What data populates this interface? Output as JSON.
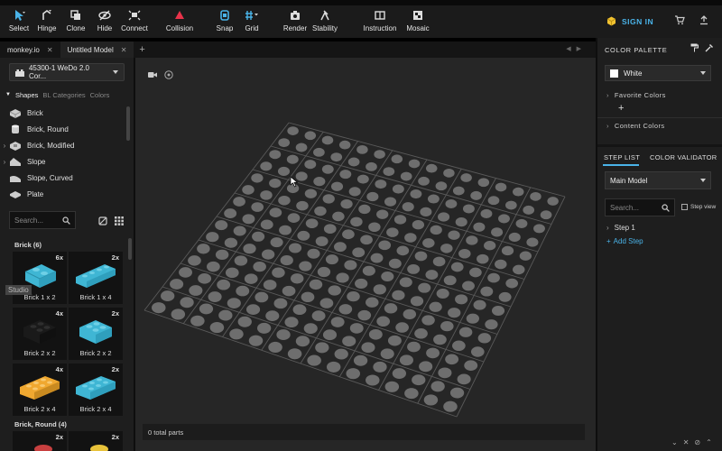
{
  "toolbar": {
    "tools": [
      {
        "label": "Select",
        "icon": "cursor-icon"
      },
      {
        "label": "Hinge",
        "icon": "hinge-icon"
      },
      {
        "label": "Clone",
        "icon": "clone-icon"
      },
      {
        "label": "Hide",
        "icon": "eye-off-icon"
      },
      {
        "label": "Connect",
        "icon": "connect-icon"
      },
      {
        "label": "Collision",
        "icon": "collision-icon"
      },
      {
        "label": "Snap",
        "icon": "snap-icon"
      },
      {
        "label": "Grid",
        "icon": "grid-icon"
      },
      {
        "label": "Render",
        "icon": "camera-icon"
      },
      {
        "label": "Stability",
        "icon": "stability-icon"
      },
      {
        "label": "Instruction",
        "icon": "instruction-icon"
      },
      {
        "label": "Mosaic",
        "icon": "mosaic-icon"
      }
    ],
    "sign_in": "SIGN IN"
  },
  "tabs": [
    {
      "label": "monkey.io"
    },
    {
      "label": "Untitled Model"
    }
  ],
  "left_panel": {
    "set_selector": "45300-1 WeDo 2.0 Cor...",
    "shape_tabs": [
      "Shapes",
      "BL Categories",
      "Colors"
    ],
    "categories": [
      {
        "label": "Brick",
        "expandable": false
      },
      {
        "label": "Brick, Round",
        "expandable": false
      },
      {
        "label": "Brick, Modified",
        "expandable": true
      },
      {
        "label": "Slope",
        "expandable": true
      },
      {
        "label": "Slope, Curved",
        "expandable": false
      },
      {
        "label": "Plate",
        "expandable": false
      }
    ],
    "search_placeholder": "Search...",
    "groups": [
      {
        "name": "Brick (6)"
      },
      {
        "name": "Brick, Round (4)"
      }
    ],
    "bricks": [
      {
        "name": "Brick 1 x 2",
        "count": "6x",
        "color": "#3fb6d4"
      },
      {
        "name": "Brick 1 x 4",
        "count": "2x",
        "color": "#3fb6d4"
      },
      {
        "name": "Brick 2 x 2",
        "count": "4x",
        "color": "#1a1a1a"
      },
      {
        "name": "Brick 2 x 2",
        "count": "2x",
        "color": "#3fb6d4"
      },
      {
        "name": "Brick 2 x 4",
        "count": "4x",
        "color": "#f0a830"
      },
      {
        "name": "Brick 2 x 4",
        "count": "2x",
        "color": "#3fb6d4"
      }
    ],
    "round_counts": [
      "2x",
      "2x"
    ],
    "tooltip": "Studio"
  },
  "viewport": {
    "status": "0 total parts"
  },
  "right_panel": {
    "color_palette_title": "COLOR PALETTE",
    "selected_color": "White",
    "favorite_colors": "Favorite Colors",
    "content_colors": "Content Colors",
    "step_list_tab": "STEP LIST",
    "color_validator_tab": "COLOR VALIDATOR",
    "model_selector": "Main Model",
    "search_placeholder": "Search...",
    "step_view": "Step view",
    "steps": [
      "Step 1"
    ],
    "add_step": "Add Step"
  },
  "colors": {
    "accent": "#4ab3e8",
    "collision": "#e8334a",
    "signin_icon": "#f2c230"
  }
}
